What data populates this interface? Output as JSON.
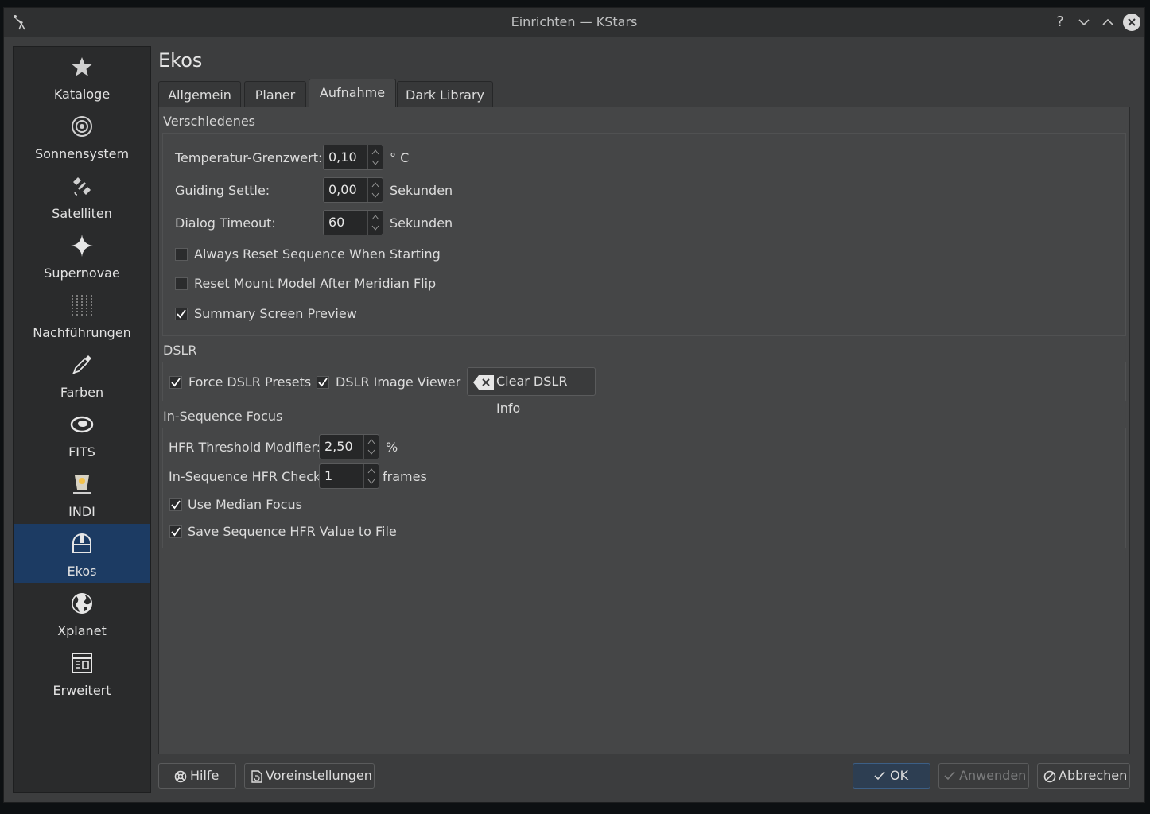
{
  "window": {
    "title": "Einrichten — KStars"
  },
  "titlebar": {
    "help": "?",
    "minimize": "⌄",
    "maximize": "⌃",
    "close": "✕"
  },
  "sidebar": {
    "items": [
      {
        "label": "Kataloge",
        "icon": "star-icon"
      },
      {
        "label": "Sonnensystem",
        "icon": "solar-system-icon"
      },
      {
        "label": "Satelliten",
        "icon": "satellite-icon"
      },
      {
        "label": "Supernovae",
        "icon": "supernova-icon"
      },
      {
        "label": "Nachführungen",
        "icon": "trails-icon"
      },
      {
        "label": "Farben",
        "icon": "color-picker-icon"
      },
      {
        "label": "FITS",
        "icon": "fits-icon"
      },
      {
        "label": "INDI",
        "icon": "indi-icon"
      },
      {
        "label": "Ekos",
        "icon": "observatory-icon",
        "active": true
      },
      {
        "label": "Xplanet",
        "icon": "globe-icon"
      },
      {
        "label": "Erweitert",
        "icon": "advanced-icon"
      }
    ]
  },
  "page": {
    "title": "Ekos"
  },
  "tabs": [
    {
      "label": "Allgemein"
    },
    {
      "label": "Planer"
    },
    {
      "label": "Aufnahme",
      "active": true
    },
    {
      "label": "Dark Library"
    }
  ],
  "misc": {
    "title": "Verschiedenes",
    "temp_label": "Temperatur-Grenzwert:",
    "temp_value": "0,10",
    "temp_unit": "° C",
    "guide_label": "Guiding Settle:",
    "guide_value": "0,00",
    "guide_unit": "Sekunden",
    "dialog_label": "Dialog Timeout:",
    "dialog_value": "60",
    "dialog_unit": "Sekunden",
    "always_reset": "Always Reset Sequence When Starting",
    "reset_mount": "Reset Mount Model After Meridian Flip",
    "summary_preview": "Summary Screen Preview"
  },
  "dslr": {
    "title": "DSLR",
    "force_presets": "Force DSLR Presets",
    "image_viewer": "DSLR Image Viewer",
    "clear_info": "Clear DSLR Info"
  },
  "focus": {
    "title": "In-Sequence Focus",
    "hfr_label": "HFR Threshold Modifier:",
    "hfr_value": "2,50",
    "hfr_unit": "%",
    "check_label": "In-Sequence HFR Check:",
    "check_value": "1",
    "check_unit": "frames",
    "median": "Use Median Focus",
    "save_hfr": "Save Sequence HFR Value to File"
  },
  "footer": {
    "help": "Hilfe",
    "defaults": "Voreinstellungen",
    "ok": "OK",
    "apply": "Anwenden",
    "cancel": "Abbrechen"
  },
  "colors": {
    "accent": "#1c3b63",
    "panel": "#454647",
    "window": "#3c3d3e"
  }
}
